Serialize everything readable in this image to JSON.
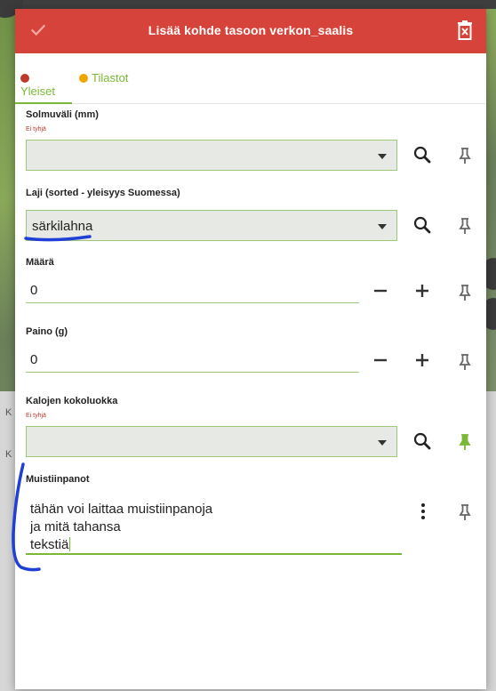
{
  "dialog": {
    "title": "Lisää kohde tasoon verkon_saalis",
    "colors": {
      "header": "#d6433a",
      "accent": "#7ab836"
    },
    "icons": {
      "confirm": "check-icon",
      "delete": "trash-icon"
    }
  },
  "tabs": [
    {
      "label": "Yleiset",
      "dot_color": "#c0392b"
    },
    {
      "label": "Tilastot",
      "dot_color": "#f0a500"
    }
  ],
  "fields": {
    "solmuvali": {
      "label": "Solmuväli (mm)",
      "hint": "Ei tyhjä",
      "value": ""
    },
    "laji": {
      "label": "Laji (sorted - yleisyys Suomessa)",
      "value": "särkilahna"
    },
    "maara": {
      "label": "Määrä",
      "value": "0"
    },
    "paino": {
      "label": "Paino (g)",
      "value": "0"
    },
    "kokoluokka": {
      "label": "Kalojen kokoluokka",
      "hint": "Ei tyhjä",
      "value": ""
    },
    "muistiinpanot": {
      "label": "Muistiinpanot",
      "lines": [
        "tähän voi laittaa muistiinpanoja",
        "ja mitä tahansa",
        "tekstiä"
      ]
    }
  },
  "background": {
    "ghost_text_1": "K",
    "ghost_text_2": "K"
  }
}
